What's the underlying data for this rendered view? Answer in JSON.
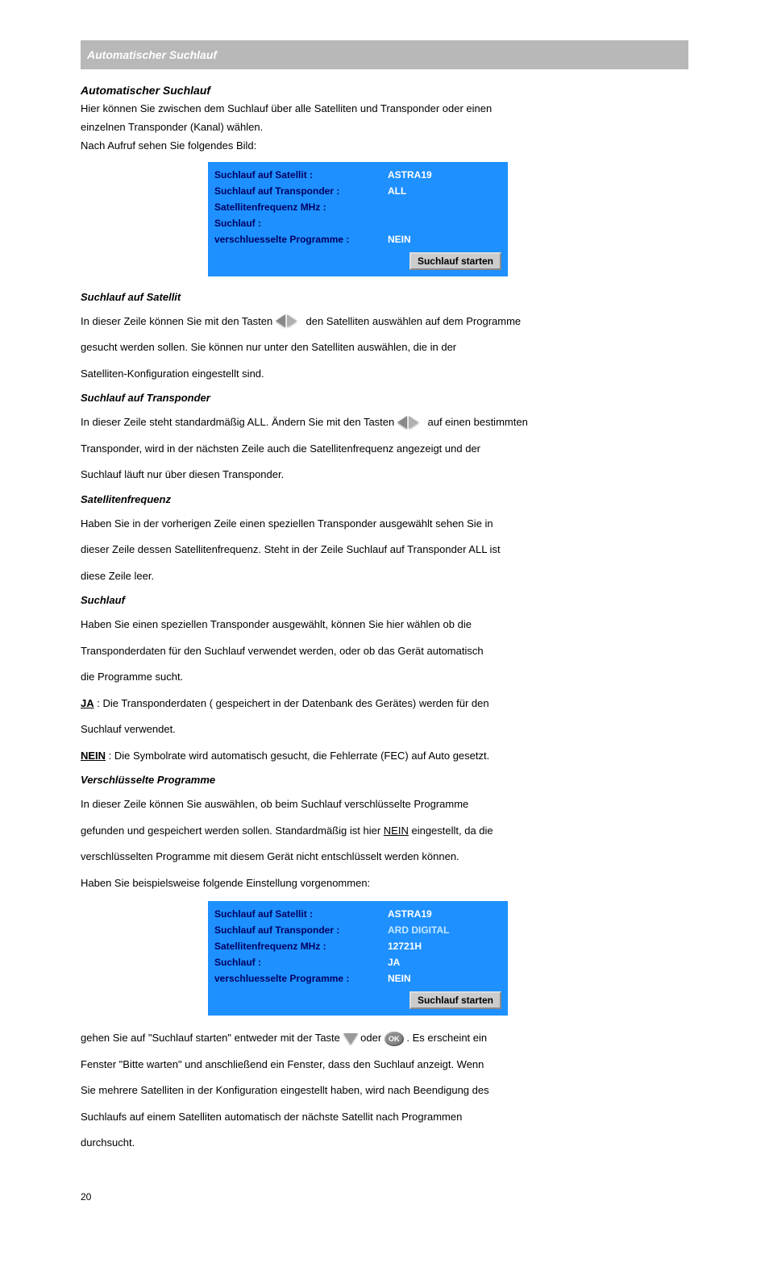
{
  "header": {
    "title": "Automatischer Suchlauf"
  },
  "intro": {
    "heading": "Automatischer Suchlauf",
    "l1": "Hier können Sie zwischen dem Suchlauf über alle Satelliten und Transponder oder einen",
    "l2": "einzelnen Transponder (Kanal) wählen.",
    "l3": "Nach Aufruf sehen Sie folgendes Bild:"
  },
  "panel1": {
    "rows": [
      {
        "label": "Suchlauf auf Satellit :",
        "value": "ASTRA19"
      },
      {
        "label": "Suchlauf auf Transponder :",
        "value": "ALL"
      },
      {
        "label": "Satellitenfrequenz MHz :",
        "value": ""
      },
      {
        "label": "Suchlauf :",
        "value": ""
      },
      {
        "label": "verschluesselte Programme :",
        "value": "NEIN"
      }
    ],
    "button": "Suchlauf starten"
  },
  "sec_sat": {
    "heading": "Suchlauf auf Satellit",
    "l1_a": "In dieser Zeile können Sie mit den Tasten ",
    "l1_b": " den Satelliten auswählen auf dem Programme",
    "l2": "gesucht werden sollen. Sie können nur unter den Satelliten auswählen, die in der",
    "l3": "Satelliten-Konfiguration eingestellt sind."
  },
  "sec_tp": {
    "heading": "Suchlauf auf Transponder",
    "l1_a": "In dieser Zeile steht standardmäßig ALL. Ändern Sie mit den Tasten ",
    "l1_b": " auf einen bestimmten",
    "l2": "Transponder, wird in der nächsten Zeile auch die Satellitenfrequenz angezeigt und der",
    "l3": "Suchlauf läuft nur über diesen Transponder."
  },
  "sec_freq": {
    "heading": "Satellitenfrequenz",
    "l1": "Haben Sie in der vorherigen Zeile einen speziellen Transponder ausgewählt sehen Sie in",
    "l2": "dieser Zeile dessen Satellitenfrequenz. Steht in der Zeile Suchlauf auf Transponder ALL ist",
    "l3": "diese Zeile leer."
  },
  "sec_run": {
    "heading": "Suchlauf",
    "l1": "Haben Sie einen speziellen Transponder ausgewählt, können Sie hier wählen ob die",
    "l2": "Transponderdaten für den Suchlauf verwendet werden, oder ob das Gerät automatisch",
    "l3": "die Programme sucht.",
    "l4_a": "JA",
    "l4_b": " : Die Transponderdaten ( gespeichert in der Datenbank des Gerätes) werden für den",
    "l5": "Suchlauf verwendet.",
    "l6_a": "NEIN",
    "l6_b": " : Die Symbolrate wird automatisch gesucht, die Fehlerrate (FEC) auf Auto gesetzt."
  },
  "sec_enc": {
    "heading": "Verschlüsselte Programme",
    "l1": "In dieser Zeile können Sie auswählen, ob beim Suchlauf verschlüsselte Programme",
    "l2_a": "gefunden und gespeichert werden sollen. Standardmäßig ist hier ",
    "l2_b": "NEIN",
    "l2_c": " eingestellt, da die",
    "l3": "verschlüsselten Programme mit diesem Gerät nicht entschlüsselt werden können.",
    "l4": "Haben Sie beispielsweise folgende Einstellung vorgenommen:"
  },
  "panel2": {
    "rows": [
      {
        "label": "Suchlauf auf Satellit :",
        "value": "ASTRA19"
      },
      {
        "label": "Suchlauf auf Transponder :",
        "value": "ARD DIGITAL",
        "white": true
      },
      {
        "label": "Satellitenfrequenz MHz :",
        "value": "12721H"
      },
      {
        "label": "Suchlauf :",
        "value": "JA"
      },
      {
        "label": "verschluesselte Programme :",
        "value": "NEIN"
      }
    ],
    "button": "Suchlauf starten"
  },
  "closing": {
    "l1_a": "gehen Sie auf \"Suchlauf starten\" entweder mit der Taste ",
    "l1_b": " oder ",
    "l1_c": " . Es erscheint ein",
    "l2": "Fenster \"Bitte warten\" und anschließend ein Fenster, dass den Suchlauf anzeigt. Wenn",
    "l3": "Sie mehrere Satelliten in der Konfiguration eingestellt haben, wird nach Beendigung des",
    "l4": "Suchlaufs auf einem Satelliten automatisch der nächste Satellit nach Programmen",
    "l5": "durchsucht."
  },
  "ok_label": "OK",
  "page_number": "20"
}
